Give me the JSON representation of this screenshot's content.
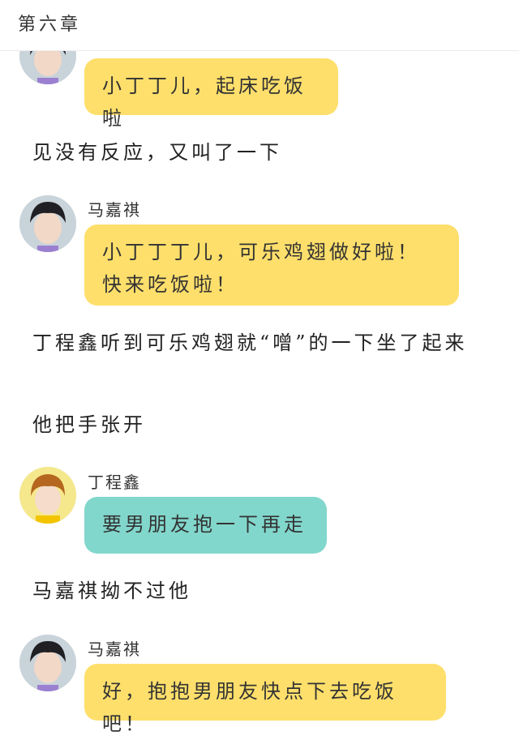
{
  "header": {
    "title": "第六章"
  },
  "blocks": {
    "m1": {
      "text": "小丁丁儿，起床吃饭啦"
    },
    "n1": {
      "text": "见没有反应，又叫了一下"
    },
    "m2": {
      "speaker": "马嘉祺",
      "text": "小丁丁丁儿，可乐鸡翅做好啦！快来吃饭啦！"
    },
    "n2": {
      "text": "丁程鑫听到可乐鸡翅就“噌”的一下坐了起来"
    },
    "n3": {
      "text": "他把手张开"
    },
    "m3": {
      "speaker": "丁程鑫",
      "text": "要男朋友抱一下再走"
    },
    "n4": {
      "text": "马嘉祺拗不过他"
    },
    "m4": {
      "speaker": "马嘉祺",
      "text": "好，抱抱男朋友快点下去吃饭吧！"
    }
  },
  "colors": {
    "bubble_yellow": "#fedf6b",
    "bubble_teal": "#82d7cc"
  }
}
